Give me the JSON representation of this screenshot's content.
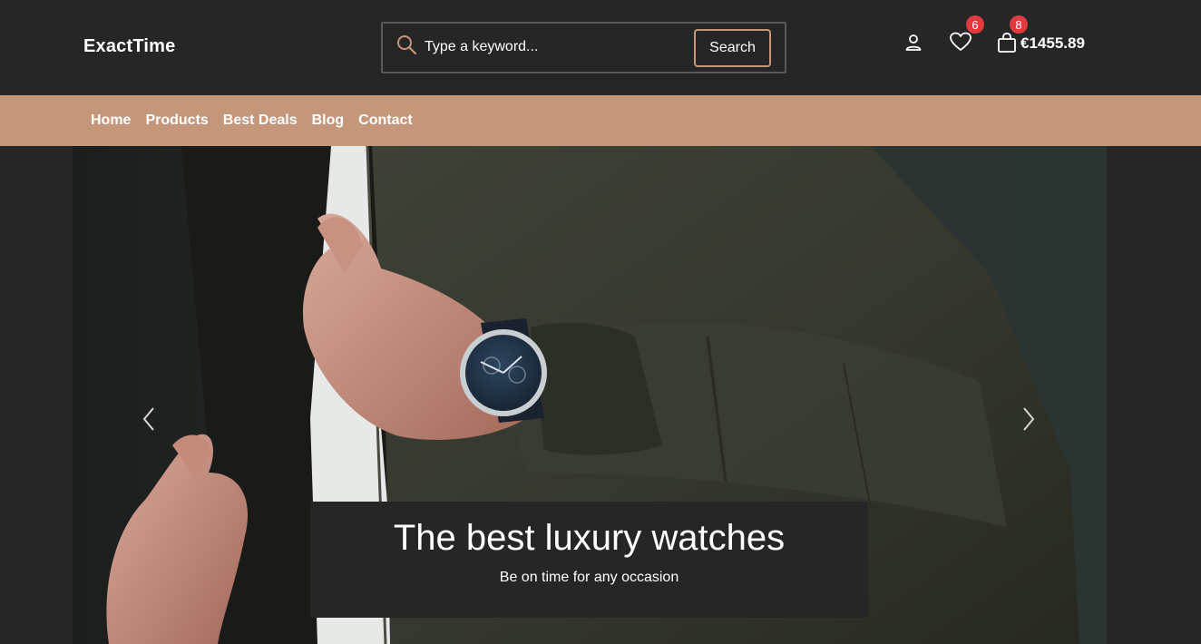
{
  "header": {
    "logo": "ExactTime",
    "search": {
      "placeholder": "Type a keyword...",
      "button": "Search"
    },
    "wishlist_count": "6",
    "cart_count": "8",
    "cart_total": "€1455.89"
  },
  "nav": {
    "items": [
      "Home",
      "Products",
      "Best Deals",
      "Blog",
      "Contact"
    ]
  },
  "hero": {
    "title": "The best luxury watches",
    "subtitle": "Be on time for any occasion"
  },
  "colors": {
    "background": "#262626",
    "accent": "#c4967a",
    "badge": "#e23a3f"
  },
  "icons": [
    "search-icon",
    "user-icon",
    "heart-icon",
    "shopping-bag-icon",
    "chevron-left-icon",
    "chevron-right-icon"
  ]
}
